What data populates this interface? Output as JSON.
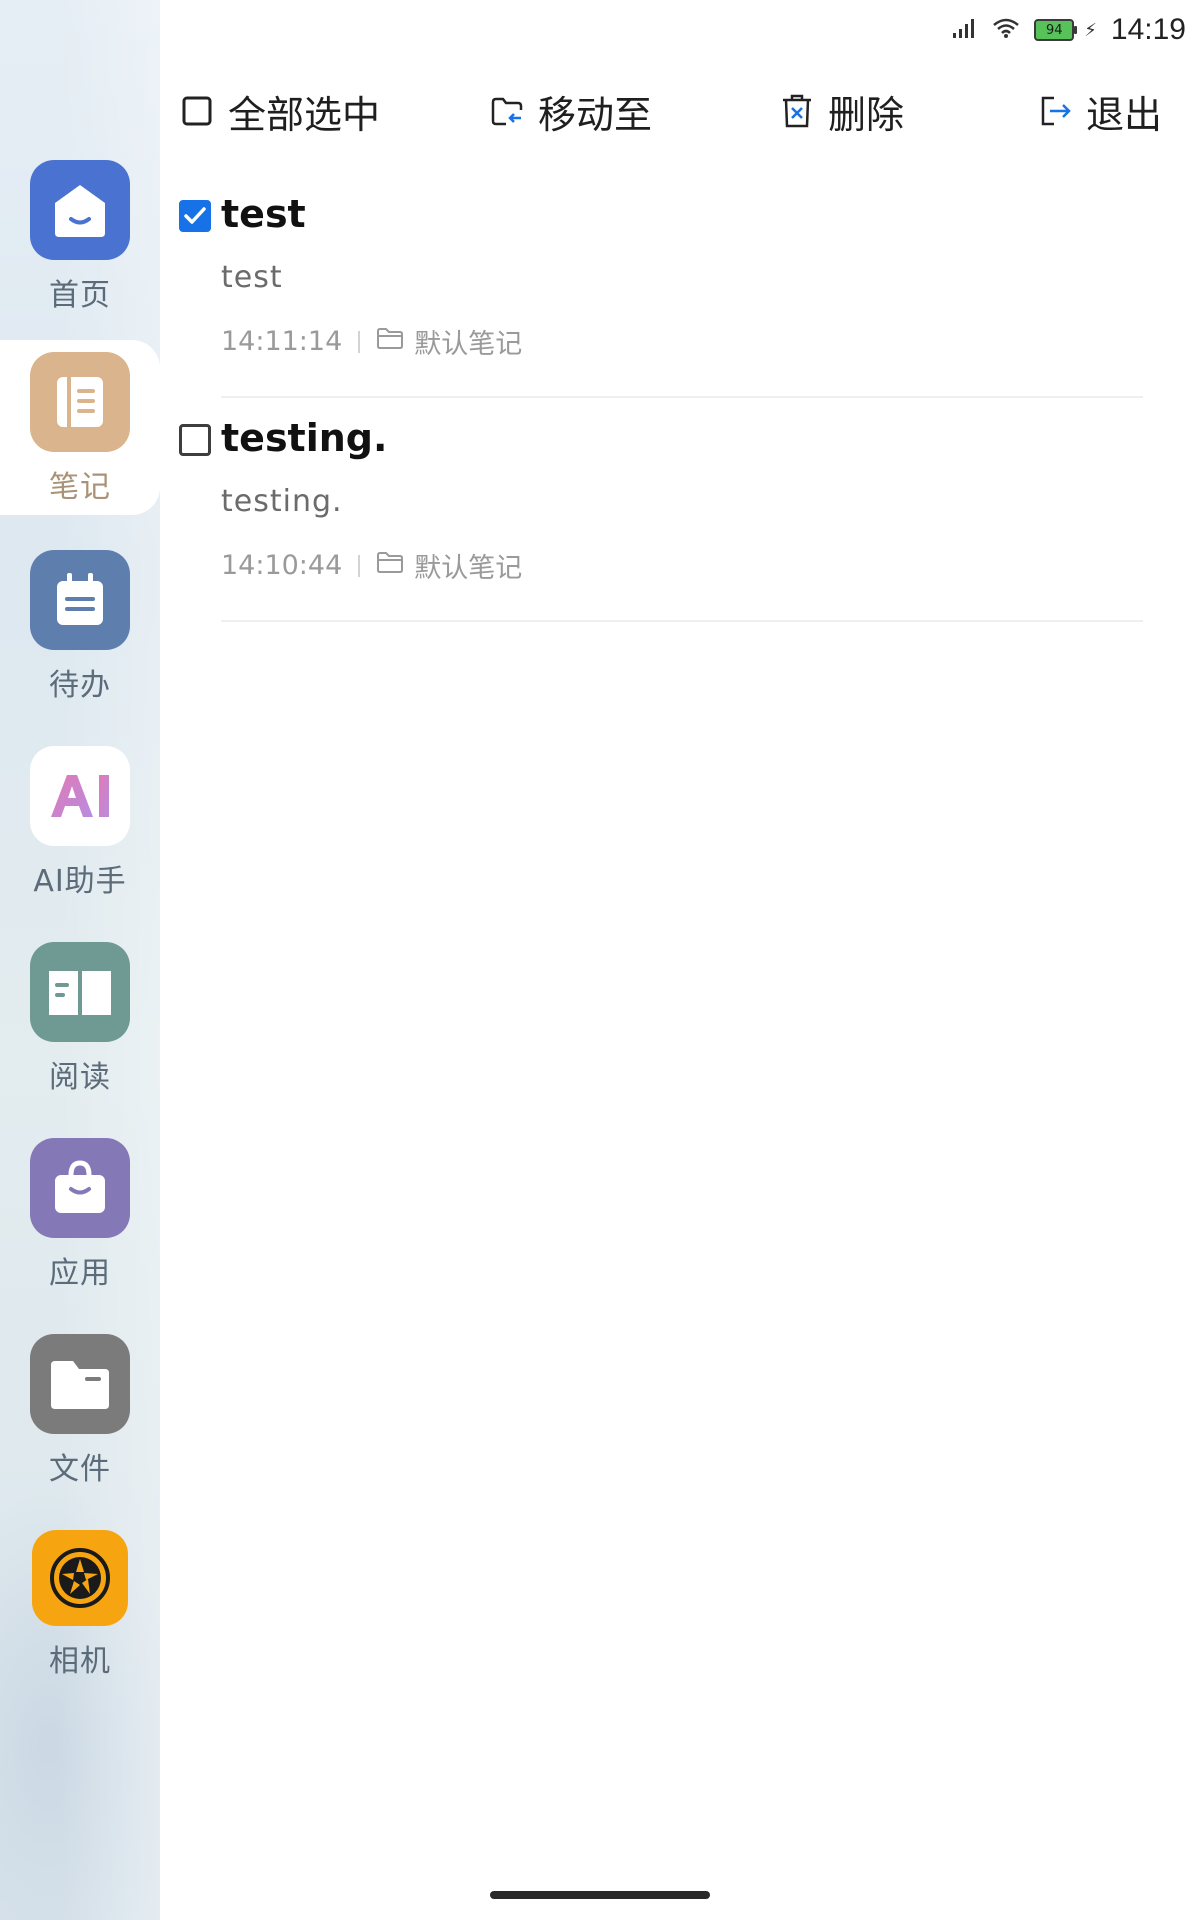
{
  "status_bar": {
    "time": "14:19",
    "battery_level": "94",
    "icons": [
      "signal-icon",
      "wifi-icon",
      "battery-icon",
      "charging-icon"
    ]
  },
  "toolbar": {
    "select_all": "全部选中",
    "move_to": "移动至",
    "delete": "删除",
    "exit": "退出"
  },
  "sidebar": {
    "items": [
      {
        "label": "首页",
        "icon": "home-icon",
        "color": "#4a72d0"
      },
      {
        "label": "笔记",
        "icon": "notebook-icon",
        "color": "#d9b48c",
        "active": true
      },
      {
        "label": "待办",
        "icon": "calendar-icon",
        "color": "#5e7fae"
      },
      {
        "label": "AI助手",
        "icon": "ai-icon",
        "color": "#ffffff"
      },
      {
        "label": "阅读",
        "icon": "book-icon",
        "color": "#6f9a94"
      },
      {
        "label": "应用",
        "icon": "shopping-bag-icon",
        "color": "#8478b6"
      },
      {
        "label": "文件",
        "icon": "folder-icon",
        "color": "#7b7b7b"
      },
      {
        "label": "相机",
        "icon": "camera-aperture-icon",
        "color": "#f7a411"
      }
    ]
  },
  "notes": [
    {
      "title": "test",
      "body": "test",
      "time": "14:11:14",
      "folder": "默认笔记",
      "checked": true
    },
    {
      "title": "testing.",
      "body": "testing.",
      "time": "14:10:44",
      "folder": "默认笔记",
      "checked": false
    }
  ],
  "colors": {
    "accent": "#1772e8",
    "notes_active_label": "#a99275"
  }
}
